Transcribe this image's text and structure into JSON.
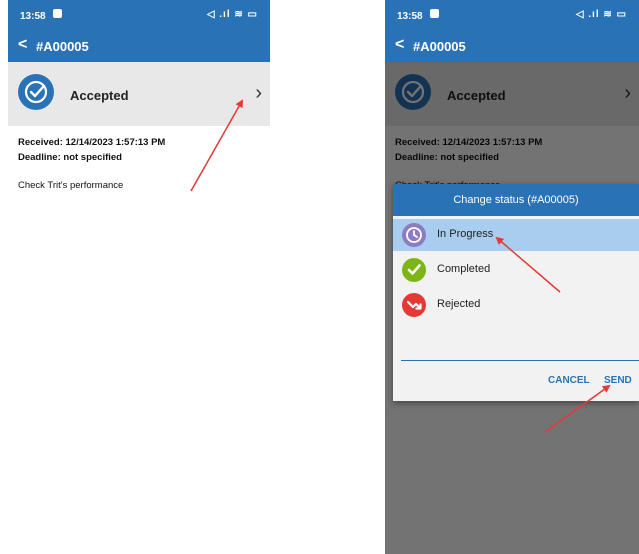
{
  "status_bar": {
    "time": "13:58",
    "system_icons": "◁ .ıl ≋ ▭"
  },
  "app_bar": {
    "back_icon": "<",
    "title": "#A00005"
  },
  "card": {
    "status_label": "Accepted",
    "chevron": "›"
  },
  "details": {
    "received": "Received: 12/14/2023 1:57:13 PM",
    "deadline": "Deadline: not specified",
    "description": "Check Trit's performance"
  },
  "dialog": {
    "title": "Change status (#A00005)",
    "options": [
      {
        "label": "In Progress",
        "icon": "clock-icon",
        "color": "#8e7cc3",
        "selected": true
      },
      {
        "label": "Completed",
        "icon": "check-icon",
        "color": "#7cb518",
        "selected": false
      },
      {
        "label": "Rejected",
        "icon": "rejected-arrow-icon",
        "color": "#e53935",
        "selected": false
      }
    ],
    "cancel_label": "CANCEL",
    "send_label": "SEND"
  },
  "colors": {
    "accent": "#2a72b6",
    "annotation_arrow": "#e53935"
  }
}
